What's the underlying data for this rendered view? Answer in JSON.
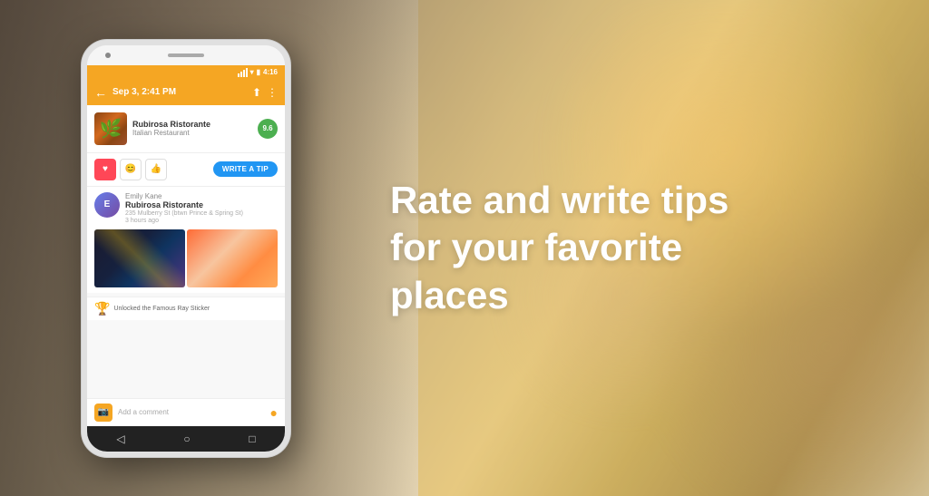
{
  "background": {
    "color_left": "#6b5a45",
    "color_right": "#c8a860"
  },
  "phone": {
    "status_bar": {
      "time": "4:16",
      "wifi": "▾",
      "battery": "▮"
    },
    "header": {
      "back_icon": "←",
      "title": "Sep 3, 2:41 PM",
      "share_icon": "⬆",
      "more_icon": "⋮"
    },
    "restaurant": {
      "name": "Rubirosa Ristorante",
      "type": "Italian Restaurant",
      "score": "9.6"
    },
    "action_bar": {
      "like_icon": "♥",
      "emoji1_icon": "😊",
      "emoji2_icon": "👍",
      "write_tip_label": "WRITE A TIP"
    },
    "feed": {
      "user_name": "Emily Kane",
      "venue_name": "Rubirosa Ristorante",
      "address": "235 Mulberry St (btwn Prince & Spring St)",
      "time_ago": "3 hours ago",
      "sticker_text": "Unlocked the Famous Ray Sticker"
    },
    "comment_bar": {
      "placeholder": "Add a comment",
      "send_icon": "●"
    },
    "bottom_nav": {
      "back_icon": "◁",
      "home_icon": "○",
      "square_icon": "□"
    }
  },
  "hero": {
    "line1": "Rate and write tips",
    "line2": "for your favorite",
    "line3": "places"
  },
  "colors": {
    "orange": "#f5a623",
    "blue": "#2196F3",
    "green": "#4CAF50",
    "red": "#ff4757",
    "dark": "#222222"
  }
}
